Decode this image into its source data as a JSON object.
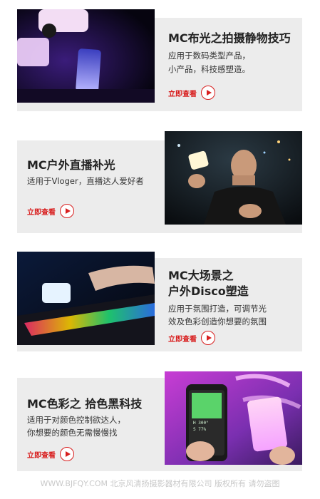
{
  "cards": [
    {
      "title": "MC布光之拍摄静物技巧",
      "desc_lines": [
        "应用于数码类型产品，",
        "小产品，科技感塑造。"
      ],
      "cta_label": "立即查看"
    },
    {
      "title": "MC户外直播补光",
      "desc_lines": [
        "适用于Vloger，直播达人爱好者"
      ],
      "cta_label": "立即查看"
    },
    {
      "title_lines": [
        "MC大场景之",
        "户外Disco塑造"
      ],
      "desc_lines": [
        "应用于氛围打造，可调节光",
        "效及色彩创造你想要的氛围"
      ],
      "cta_label": "立即查看"
    },
    {
      "title": "MC色彩之 拾色黑科技",
      "desc_lines": [
        "适用于对颜色控制欲达人，",
        "你想要的颜色无需慢慢找"
      ],
      "cta_label": "立即查看"
    }
  ],
  "phone_readouts": [
    "H 300°",
    "S 77%"
  ],
  "footer": "WWW.BJFQY.COM 北京风清扬摄影器材有限公司 版权所有 请勿盗图",
  "colors": {
    "accent": "#d81e1e",
    "card_bg": "#ececec",
    "footer_text": "#c9c9c9"
  }
}
